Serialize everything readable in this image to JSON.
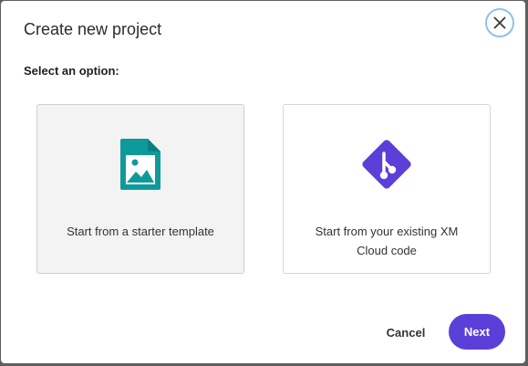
{
  "dialog": {
    "title": "Create new project",
    "subtitle": "Select an option:",
    "close_icon": "close-icon"
  },
  "options": [
    {
      "label": "Start from a starter template",
      "icon": "image-file-icon",
      "icon_color": "#0f9a9a",
      "selected": true
    },
    {
      "label": "Start from your existing XM Cloud code",
      "icon": "git-icon",
      "icon_color": "#5a3fd9",
      "selected": false
    }
  ],
  "footer": {
    "cancel_label": "Cancel",
    "next_label": "Next"
  },
  "colors": {
    "accent": "#5a3fd9",
    "teal": "#0f9a9a",
    "focus_ring": "#8ec2ea"
  }
}
